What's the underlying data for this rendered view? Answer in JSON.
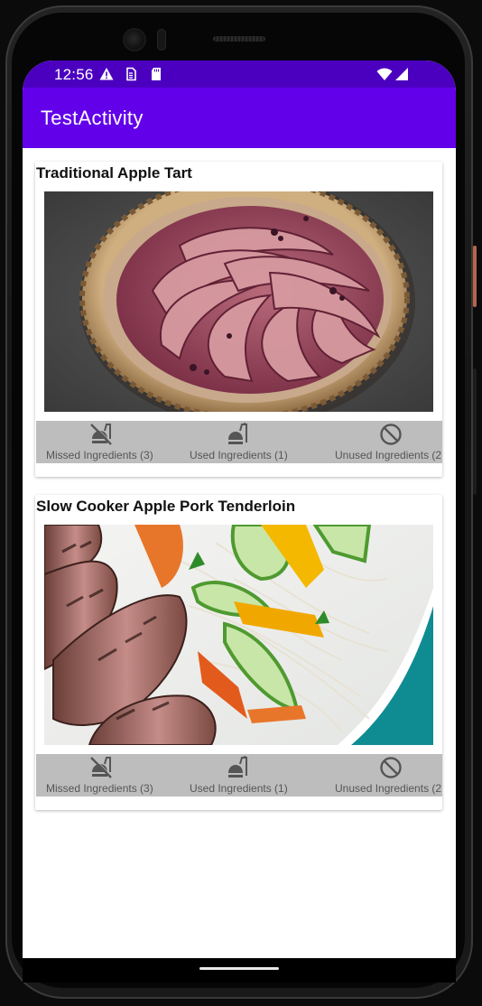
{
  "status_bar": {
    "time": "12:56",
    "icons": [
      "warning-icon",
      "sim-card-icon",
      "sd-card-icon",
      "wifi-icon",
      "signal-icon"
    ]
  },
  "app_bar": {
    "title": "TestActivity"
  },
  "recipes": [
    {
      "title": "Traditional Apple Tart",
      "image": "apple-tart-photo",
      "actions": {
        "missed": "Missed Ingredients (3)",
        "used": "Used Ingredients (1)",
        "unused": "Unused Ingredients (2"
      }
    },
    {
      "title": "Slow Cooker Apple Pork Tenderloin",
      "image": "pork-tenderloin-noodle-salad-photo",
      "actions": {
        "missed": "Missed Ingredients (3)",
        "used": "Used Ingredients (1)",
        "unused": "Unused Ingredients (2"
      }
    }
  ],
  "colors": {
    "status_bar": "#4b00c0",
    "app_bar": "#6200ea",
    "action_bar": "#bdbdbd",
    "action_text": "#555555"
  }
}
